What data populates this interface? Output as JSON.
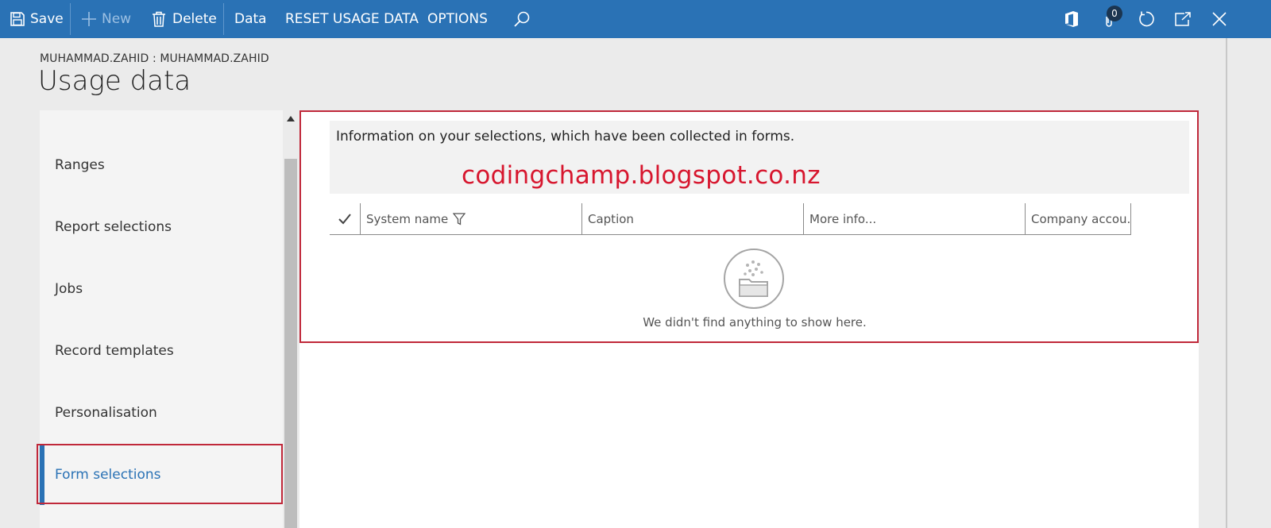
{
  "toolbar": {
    "save_label": "Save",
    "new_label": "New",
    "delete_label": "Delete",
    "data_label": "Data",
    "reset_label": "RESET USAGE DATA",
    "options_label": "OPTIONS",
    "attachments_count": "0"
  },
  "header": {
    "user": "MUHAMMAD.ZAHID : MUHAMMAD.ZAHID",
    "title": "Usage data"
  },
  "nav": {
    "items": [
      {
        "label": "Ranges"
      },
      {
        "label": "Report selections"
      },
      {
        "label": "Jobs"
      },
      {
        "label": "Record templates"
      },
      {
        "label": "Personalisation"
      },
      {
        "label": "Form selections",
        "selected": true
      }
    ]
  },
  "content": {
    "info": "Information on your selections, which have been collected in forms.",
    "watermark": "codingchamp.blogspot.co.nz",
    "columns": [
      "System name",
      "Caption",
      "More info...",
      "Company accou..."
    ],
    "empty_message": "We didn't find anything to show here."
  },
  "colors": {
    "accent": "#2a72b5",
    "highlight": "#c0283a",
    "watermark": "#d7162e"
  }
}
